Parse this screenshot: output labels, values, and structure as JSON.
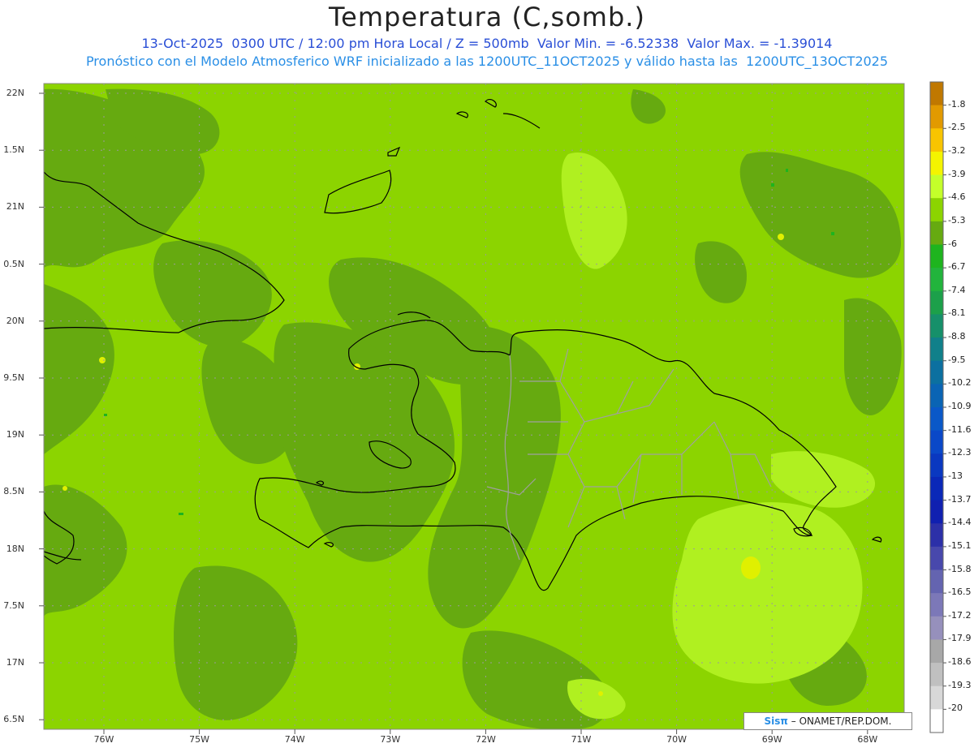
{
  "header": {
    "title": "Temperatura (C,somb.)",
    "line1": "13-Oct-2025  0300 UTC / 12:00 pm Hora Local / Z = 500mb  Valor Min. = -6.52338  Valor Max. = -1.39014",
    "line2": "Pronóstico con el Modelo Atmosferico WRF inicializado a las 1200UTC_11OCT2025 y válido hasta las  1200UTC_13OCT2025"
  },
  "axes": {
    "lat_labels": [
      "22N",
      "1.5N",
      "21N",
      "0.5N",
      "20N",
      "9.5N",
      "19N",
      "8.5N",
      "18N",
      "7.5N",
      "17N",
      "6.5N"
    ],
    "lon_labels": [
      "76W",
      "75W",
      "74W",
      "73W",
      "72W",
      "71W",
      "70W",
      "69W",
      "68W"
    ]
  },
  "colorbar": {
    "labels": [
      "-1.8",
      "-2.5",
      "-3.2",
      "-3.9",
      "-4.6",
      "-5.3",
      "-6",
      "-6.7",
      "-7.4",
      "-8.1",
      "-8.8",
      "-9.5",
      "-10.2",
      "-10.9",
      "-11.6",
      "-12.3",
      "-13",
      "-13.7",
      "-14.4",
      "-15.1",
      "-15.8",
      "-16.5",
      "-17.2",
      "-17.9",
      "-18.6",
      "-19.3",
      "-20"
    ],
    "colors": [
      "#c07800",
      "#e29a00",
      "#f8c400",
      "#f4f400",
      "#c4ff2a",
      "#8cd400",
      "#66aa10",
      "#1eb41e",
      "#22b43c",
      "#1ca04a",
      "#16906a",
      "#10808a",
      "#0c70a0",
      "#0a64b4",
      "#0a58c8",
      "#0a48c8",
      "#0a38c0",
      "#0a28b8",
      "#1020b0",
      "#2c30a8",
      "#4848ac",
      "#6464b0",
      "#7c78b8",
      "#9690bc",
      "#a8a8a8",
      "#c0c0c0",
      "#d8d8d8",
      "#ffffff"
    ]
  },
  "field": {
    "base_color": "#8cd400",
    "darker_color": "#66aa10",
    "lighter_color": "#b0f020",
    "yellow_color": "#e0f000"
  },
  "credit": {
    "brand": "Sisπ",
    "text": "– ONAMET/REP.DOM."
  }
}
